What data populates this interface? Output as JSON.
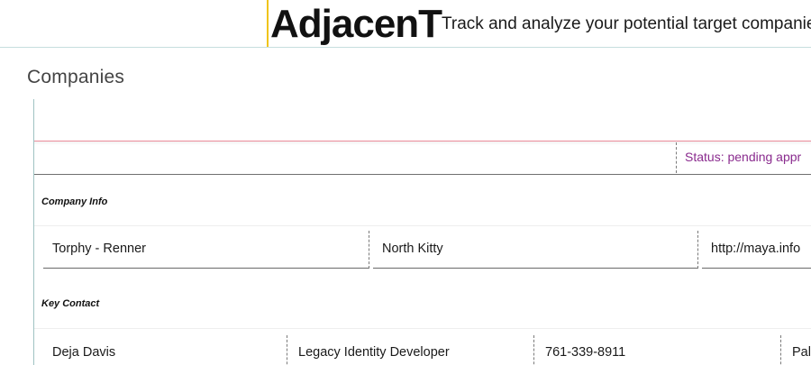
{
  "header": {
    "brand": "AdjacenT",
    "tagline": "Track and analyze your potential target companies."
  },
  "section": {
    "title": "Companies"
  },
  "card": {
    "status": "Status: pending appr",
    "company_info": {
      "label": "Company Info",
      "name": "Torphy - Renner",
      "city": "North Kitty",
      "website": "http://maya.info"
    },
    "key_contact": {
      "label": "Key Contact",
      "name": "Deja Davis",
      "title": "Legacy Identity Developer",
      "phone": "761-339-8911",
      "extra": "Pal"
    }
  },
  "colors": {
    "accent_gold": "#f0c419",
    "status_text": "#8a2b8e",
    "card_topline": "#ec8d9b",
    "rule_teal": "#9fc3c3"
  }
}
